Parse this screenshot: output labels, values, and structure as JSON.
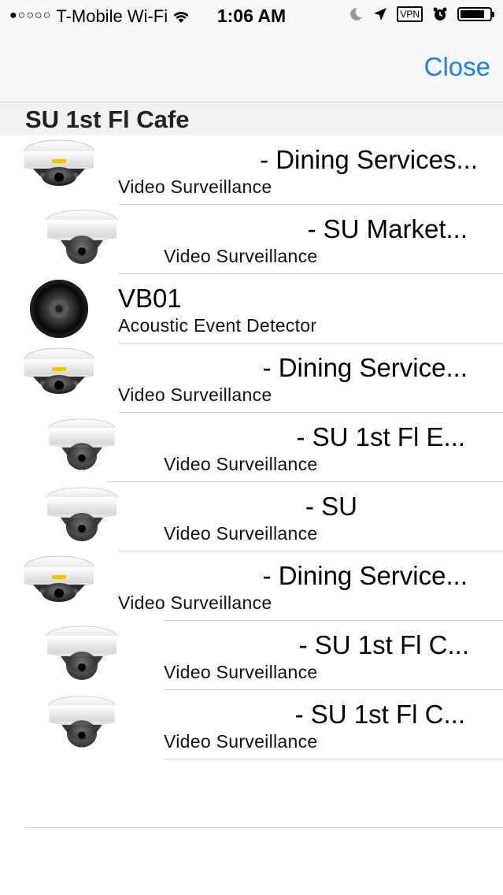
{
  "status_bar": {
    "signal": "●○○○○",
    "carrier": "T-Mobile Wi-Fi",
    "time": "1:06 AM",
    "vpn": "VPN",
    "battery_percent": 85,
    "icons": [
      "wifi-icon",
      "moon-icon",
      "location-arrow-icon",
      "vpn-badge",
      "alarm-clock-icon",
      "battery-icon"
    ]
  },
  "nav": {
    "close_label": "Close"
  },
  "section": {
    "title": "SU 1st Fl Cafe"
  },
  "rows": [
    {
      "title": "- Dining Services...",
      "subtitle": "Video Surveillance",
      "icon": "dome-camera-axis-icon"
    },
    {
      "title": "- SU Market...",
      "subtitle": "Video Surveillance",
      "icon": "dome-camera-white-icon"
    },
    {
      "title": "VB01",
      "subtitle": "Acoustic Event Detector",
      "icon": "speaker-icon"
    },
    {
      "title": "- Dining Service...",
      "subtitle": "Video Surveillance",
      "icon": "dome-camera-axis-icon"
    },
    {
      "title": "- SU 1st Fl E...",
      "subtitle": "Video Surveillance",
      "icon": "dome-camera-white-icon"
    },
    {
      "title": "- SU",
      "subtitle": "Video Surveillance",
      "icon": "dome-camera-white-icon"
    },
    {
      "title": "- Dining Service...",
      "subtitle": "Video Surveillance",
      "icon": "dome-camera-axis-icon"
    },
    {
      "title": "- SU 1st Fl C...",
      "subtitle": "Video Surveillance",
      "icon": "dome-camera-white-icon"
    },
    {
      "title": "- SU 1st Fl C...",
      "subtitle": "Video Surveillance",
      "icon": "dome-camera-white-icon"
    }
  ],
  "colors": {
    "accent": "#1a7ff5",
    "separator": "#d8d8d8",
    "header_bg": "#f1f1f1"
  }
}
